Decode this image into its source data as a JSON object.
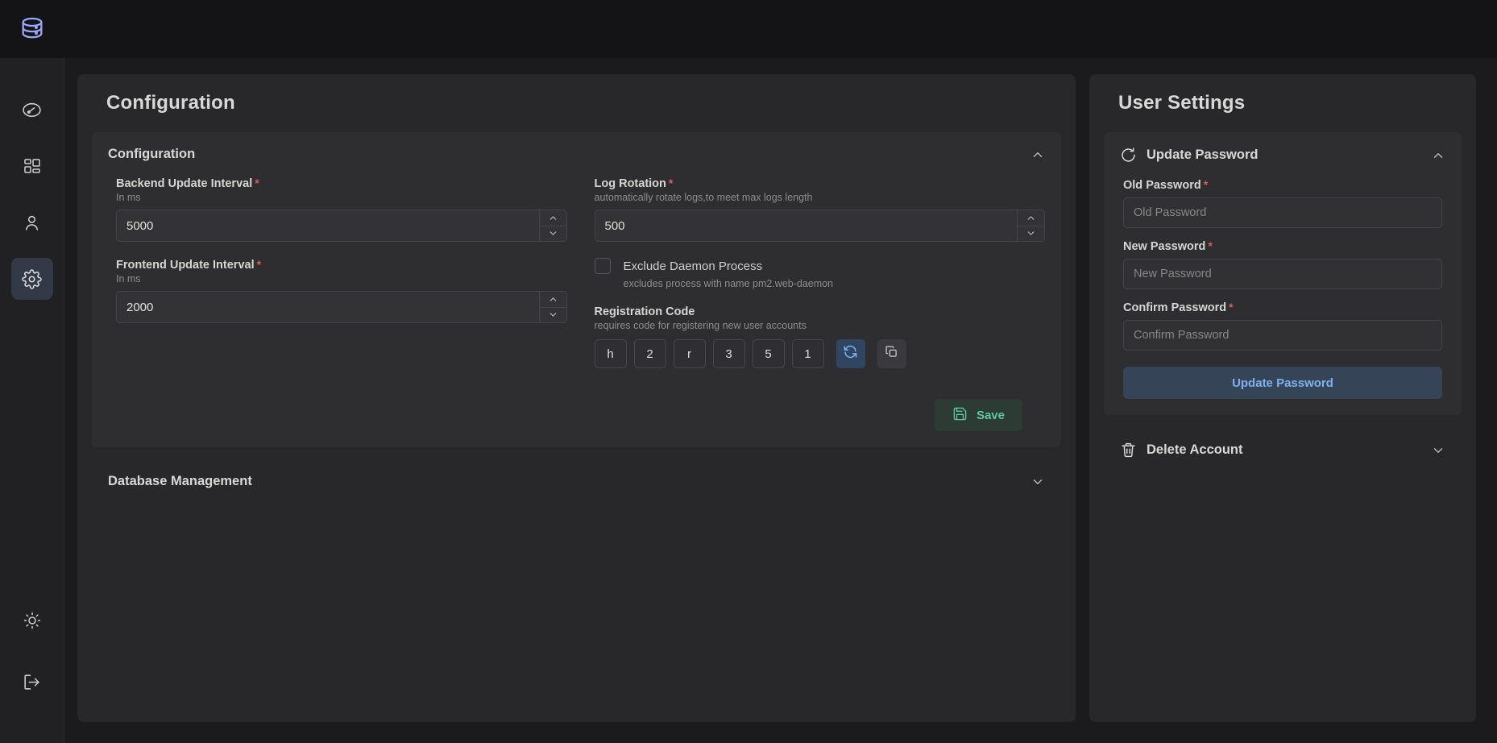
{
  "app": {
    "logo_icon": "database-stack-icon",
    "accent_blue": "#7eb1ee",
    "accent_green": "#5fc99a",
    "required_color": "#e05b5b"
  },
  "sidebar": {
    "items": [
      {
        "icon": "dashboard-gauge-icon",
        "name": "dashboard",
        "active": false
      },
      {
        "icon": "grid-apps-icon",
        "name": "applications",
        "active": false
      },
      {
        "icon": "user-icon",
        "name": "users",
        "active": false
      },
      {
        "icon": "gear-icon",
        "name": "settings",
        "active": true
      }
    ],
    "bottom_items": [
      {
        "icon": "sun-icon",
        "name": "theme-toggle"
      },
      {
        "icon": "logout-icon",
        "name": "logout"
      }
    ]
  },
  "configuration_panel": {
    "title": "Configuration",
    "sections": [
      {
        "title": "Configuration",
        "expanded": true,
        "chevron": "chevron-up-icon"
      },
      {
        "title": "Database Management",
        "expanded": false,
        "chevron": "chevron-down-icon"
      }
    ],
    "fields": {
      "backend_update_interval": {
        "label": "Backend Update Interval",
        "required": "*",
        "hint": "In ms",
        "value": "5000"
      },
      "frontend_update_interval": {
        "label": "Frontend Update Interval",
        "required": "*",
        "hint": "In ms",
        "value": "2000"
      },
      "log_rotation": {
        "label": "Log Rotation",
        "required": "*",
        "hint": "automatically rotate logs,to meet max logs length",
        "value": "500"
      },
      "exclude_daemon_process": {
        "label": "Exclude Daemon Process",
        "hint": "excludes process with name pm2.web-daemon",
        "checked": false
      },
      "registration_code": {
        "label": "Registration Code",
        "hint": "requires code for registering new user accounts",
        "characters": [
          "h",
          "2",
          "r",
          "3",
          "5",
          "1"
        ],
        "refresh_icon": "refresh-icon",
        "copy_icon": "copy-icon"
      }
    },
    "save_button": {
      "label": "Save",
      "icon": "save-floppy-icon"
    }
  },
  "user_settings_panel": {
    "title": "User Settings",
    "sections": [
      {
        "title": "Update Password",
        "icon": "refresh-password-icon",
        "expanded": true,
        "chevron": "chevron-up-icon"
      },
      {
        "title": "Delete Account",
        "icon": "trash-icon",
        "expanded": false,
        "chevron": "chevron-down-icon"
      }
    ],
    "fields": {
      "old_password": {
        "label": "Old Password",
        "required": "*",
        "placeholder": "Old Password",
        "value": ""
      },
      "new_password": {
        "label": "New Password",
        "required": "*",
        "placeholder": "New Password",
        "value": ""
      },
      "confirm_password": {
        "label": "Confirm Password",
        "required": "*",
        "placeholder": "Confirm Password",
        "value": ""
      }
    },
    "update_button": {
      "label": "Update Password"
    }
  }
}
